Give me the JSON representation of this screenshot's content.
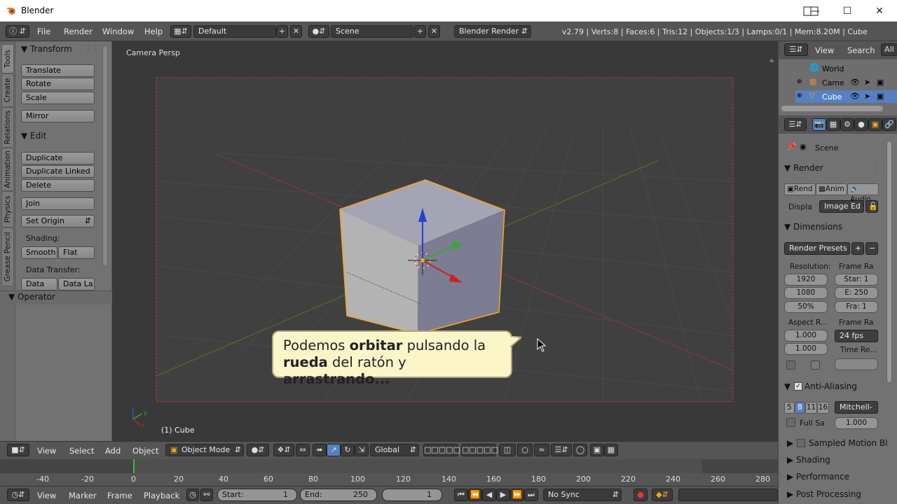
{
  "window": {
    "title": "Blender"
  },
  "info": {
    "menus": [
      "File",
      "Render",
      "Window",
      "Help"
    ],
    "layout": "Default",
    "scene": "Scene",
    "engine": "Blender Render",
    "stats": "v2.79 | Verts:8 | Faces:6 | Tris:12 | Objects:1/3 | Lamps:0/1 | Mem:8.20M | Cube"
  },
  "tabs": [
    "Tools",
    "Create",
    "Relations",
    "Animation",
    "Physics",
    "Grease Pencil"
  ],
  "tools": {
    "transform_header": "Transform",
    "translate": "Translate",
    "rotate": "Rotate",
    "scale": "Scale",
    "mirror": "Mirror",
    "edit_header": "Edit",
    "duplicate": "Duplicate",
    "duplicate_linked": "Duplicate Linked",
    "delete": "Delete",
    "join": "Join",
    "set_origin": "Set Origin",
    "shading_label": "Shading:",
    "smooth": "Smooth",
    "flat": "Flat",
    "data_transfer_label": "Data Transfer:",
    "data": "Data",
    "data_la": "Data La",
    "operator_header": "Operator"
  },
  "viewport": {
    "label": "Camera Persp",
    "object_label": "(1) Cube",
    "caption_1a": "Podemos ",
    "caption_1b": "orbitar",
    "caption_1c": " pulsando la",
    "caption_2a": "rueda",
    "caption_2b": " del ratón y ",
    "caption_2c": "arrastrando..."
  },
  "vpheader": {
    "view": "View",
    "select": "Select",
    "add": "Add",
    "object": "Object",
    "mode": "Object Mode",
    "orientation": "Global"
  },
  "timeline": {
    "ticks": [
      "-40",
      "-20",
      "0",
      "20",
      "40",
      "60",
      "80",
      "100",
      "120",
      "140",
      "160",
      "180",
      "200",
      "220",
      "240",
      "260",
      "280"
    ],
    "view": "View",
    "marker": "Marker",
    "frame": "Frame",
    "playback": "Playback",
    "start_label": "Start:",
    "start_val": "1",
    "end_label": "End:",
    "end_val": "250",
    "current": "1",
    "sync": "No Sync"
  },
  "outliner": {
    "view": "View",
    "search": "Search",
    "all": "All",
    "items": [
      "World",
      "Came",
      "Cube"
    ]
  },
  "props": {
    "scene": "Scene",
    "render_header": "Render",
    "render_btn": "Rend",
    "anim_btn": "Anim",
    "audio_btn": "Audio",
    "display_label": "Displa",
    "display_val": "Image Ed",
    "dimensions_header": "Dimensions",
    "presets": "Render Presets",
    "resolution_label": "Resolution:",
    "res_x": "1920",
    "res_y": "1080",
    "res_pct": "50%",
    "frame_range_label": "Frame Ra",
    "start": "Star: 1",
    "end": "E: 250",
    "step": "Fra: 1",
    "aspect_label": "Aspect R...",
    "aspect_x": "1.000",
    "aspect_y": "1.000",
    "frame_rate_label": "Frame Ra",
    "fps": "24 fps",
    "time_remap_label": "Time Re...",
    "aa_header": "Anti-Aliasing",
    "aa_5": "5",
    "aa_8": "8",
    "aa_11": "11",
    "aa_16": "16",
    "aa_filter": "Mitchell-",
    "full_sample": "Full Sa",
    "filter_size": "1.000",
    "sampled_motion": "Sampled Motion Bl",
    "shading": "Shading",
    "performance": "Performance",
    "post_processing": "Post Processing"
  },
  "colors": {
    "accent_orange": "#f5a623",
    "selection_blue": "#5680c2",
    "viewport_bg": "#393939"
  }
}
